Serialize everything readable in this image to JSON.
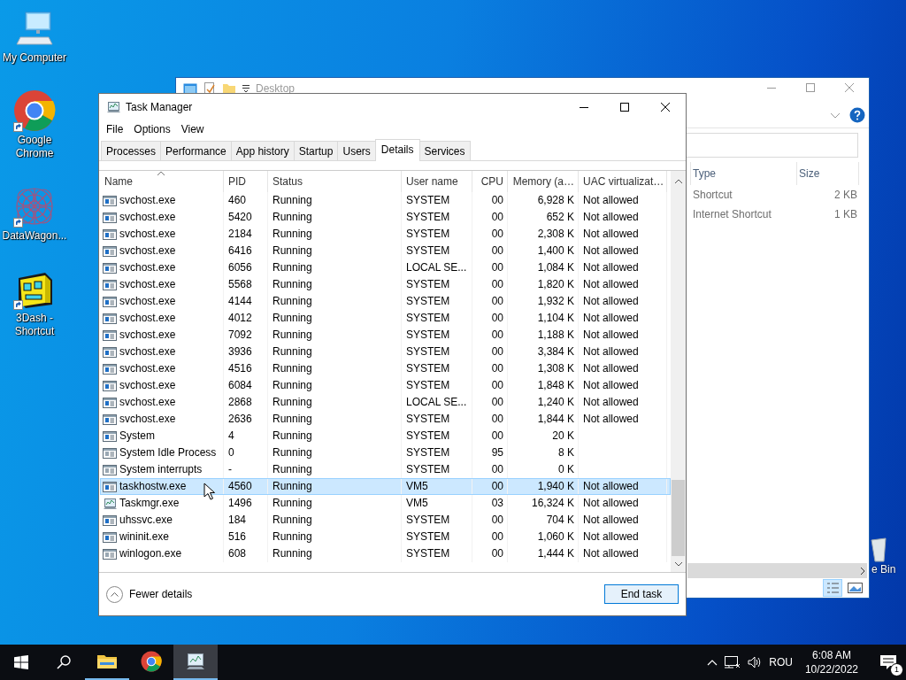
{
  "desktop_icons": [
    {
      "label": "My Computer",
      "kind": "computer",
      "shortcut": false
    },
    {
      "label": "Google Chrome",
      "kind": "chrome",
      "shortcut": true
    },
    {
      "label": "DataWagon...",
      "kind": "mesh",
      "shortcut": true
    },
    {
      "label": "3Dash - Shortcut",
      "kind": "cube",
      "shortcut": true
    }
  ],
  "explorer": {
    "title": "Desktop",
    "columns": [
      "Type",
      "Size"
    ],
    "rows": [
      {
        "type": "Shortcut",
        "size": "2 KB"
      },
      {
        "type": "Internet Shortcut",
        "size": "1 KB"
      }
    ]
  },
  "recycle_bin": {
    "label": "e Bin"
  },
  "task_manager": {
    "title": "Task Manager",
    "menu": [
      "File",
      "Options",
      "View"
    ],
    "tabs": [
      {
        "label": "Processes",
        "selected": false
      },
      {
        "label": "Performance",
        "selected": false
      },
      {
        "label": "App history",
        "selected": false
      },
      {
        "label": "Startup",
        "selected": false
      },
      {
        "label": "Users",
        "selected": false
      },
      {
        "label": "Details",
        "selected": true
      },
      {
        "label": "Services",
        "selected": false
      }
    ],
    "columns": [
      "Name",
      "PID",
      "Status",
      "User name",
      "CPU",
      "Memory (a…",
      "UAC virtualizat…"
    ],
    "rows": [
      {
        "kind": "service",
        "name": "svchost.exe",
        "pid": "460",
        "status": "Running",
        "user": "SYSTEM",
        "cpu": "00",
        "memory": "6,928 K",
        "uac": "Not allowed",
        "selected": false
      },
      {
        "kind": "service",
        "name": "svchost.exe",
        "pid": "5420",
        "status": "Running",
        "user": "SYSTEM",
        "cpu": "00",
        "memory": "652 K",
        "uac": "Not allowed",
        "selected": false
      },
      {
        "kind": "service",
        "name": "svchost.exe",
        "pid": "2184",
        "status": "Running",
        "user": "SYSTEM",
        "cpu": "00",
        "memory": "2,308 K",
        "uac": "Not allowed",
        "selected": false
      },
      {
        "kind": "service",
        "name": "svchost.exe",
        "pid": "6416",
        "status": "Running",
        "user": "SYSTEM",
        "cpu": "00",
        "memory": "1,400 K",
        "uac": "Not allowed",
        "selected": false
      },
      {
        "kind": "service",
        "name": "svchost.exe",
        "pid": "6056",
        "status": "Running",
        "user": "LOCAL SE...",
        "cpu": "00",
        "memory": "1,084 K",
        "uac": "Not allowed",
        "selected": false
      },
      {
        "kind": "service",
        "name": "svchost.exe",
        "pid": "5568",
        "status": "Running",
        "user": "SYSTEM",
        "cpu": "00",
        "memory": "1,820 K",
        "uac": "Not allowed",
        "selected": false
      },
      {
        "kind": "service",
        "name": "svchost.exe",
        "pid": "4144",
        "status": "Running",
        "user": "SYSTEM",
        "cpu": "00",
        "memory": "1,932 K",
        "uac": "Not allowed",
        "selected": false
      },
      {
        "kind": "service",
        "name": "svchost.exe",
        "pid": "4012",
        "status": "Running",
        "user": "SYSTEM",
        "cpu": "00",
        "memory": "1,104 K",
        "uac": "Not allowed",
        "selected": false
      },
      {
        "kind": "service",
        "name": "svchost.exe",
        "pid": "7092",
        "status": "Running",
        "user": "SYSTEM",
        "cpu": "00",
        "memory": "1,188 K",
        "uac": "Not allowed",
        "selected": false
      },
      {
        "kind": "service",
        "name": "svchost.exe",
        "pid": "3936",
        "status": "Running",
        "user": "SYSTEM",
        "cpu": "00",
        "memory": "3,384 K",
        "uac": "Not allowed",
        "selected": false
      },
      {
        "kind": "service",
        "name": "svchost.exe",
        "pid": "4516",
        "status": "Running",
        "user": "SYSTEM",
        "cpu": "00",
        "memory": "1,308 K",
        "uac": "Not allowed",
        "selected": false
      },
      {
        "kind": "service",
        "name": "svchost.exe",
        "pid": "6084",
        "status": "Running",
        "user": "SYSTEM",
        "cpu": "00",
        "memory": "1,848 K",
        "uac": "Not allowed",
        "selected": false
      },
      {
        "kind": "service",
        "name": "svchost.exe",
        "pid": "2868",
        "status": "Running",
        "user": "LOCAL SE...",
        "cpu": "00",
        "memory": "1,240 K",
        "uac": "Not allowed",
        "selected": false
      },
      {
        "kind": "service",
        "name": "svchost.exe",
        "pid": "2636",
        "status": "Running",
        "user": "SYSTEM",
        "cpu": "00",
        "memory": "1,844 K",
        "uac": "Not allowed",
        "selected": false
      },
      {
        "kind": "service",
        "name": "System",
        "pid": "4",
        "status": "Running",
        "user": "SYSTEM",
        "cpu": "00",
        "memory": "20 K",
        "selected": false
      },
      {
        "kind": "app",
        "name": "System Idle Process",
        "pid": "0",
        "status": "Running",
        "user": "SYSTEM",
        "cpu": "95",
        "memory": "8 K",
        "selected": false
      },
      {
        "kind": "app",
        "name": "System interrupts",
        "pid": "-",
        "status": "Running",
        "user": "SYSTEM",
        "cpu": "00",
        "memory": "0 K",
        "selected": false
      },
      {
        "kind": "service",
        "name": "taskhostw.exe",
        "pid": "4560",
        "status": "Running",
        "user": "VM5",
        "cpu": "00",
        "memory": "1,940 K",
        "uac": "Not allowed",
        "selected": true
      },
      {
        "kind": "monitor",
        "name": "Taskmgr.exe",
        "pid": "1496",
        "status": "Running",
        "user": "VM5",
        "cpu": "03",
        "memory": "16,324 K",
        "uac": "Not allowed",
        "selected": false
      },
      {
        "kind": "service",
        "name": "uhssvc.exe",
        "pid": "184",
        "status": "Running",
        "user": "SYSTEM",
        "cpu": "00",
        "memory": "704 K",
        "uac": "Not allowed",
        "selected": false
      },
      {
        "kind": "service",
        "name": "wininit.exe",
        "pid": "516",
        "status": "Running",
        "user": "SYSTEM",
        "cpu": "00",
        "memory": "1,060 K",
        "uac": "Not allowed",
        "selected": false
      },
      {
        "kind": "app",
        "name": "winlogon.exe",
        "pid": "608",
        "status": "Running",
        "user": "SYSTEM",
        "cpu": "00",
        "memory": "1,444 K",
        "uac": "Not allowed",
        "selected": false
      }
    ],
    "details_toggle": "Fewer details",
    "end_task": "End task"
  },
  "taskbar": {
    "apps": [
      {
        "kind": "folder",
        "active": false,
        "running": true
      },
      {
        "kind": "chrome",
        "active": false,
        "running": false
      },
      {
        "kind": "monitor",
        "active": true,
        "running": true
      }
    ],
    "language": "ROU",
    "time": "6:08 AM",
    "date": "10/22/2022",
    "notifications": "1"
  }
}
